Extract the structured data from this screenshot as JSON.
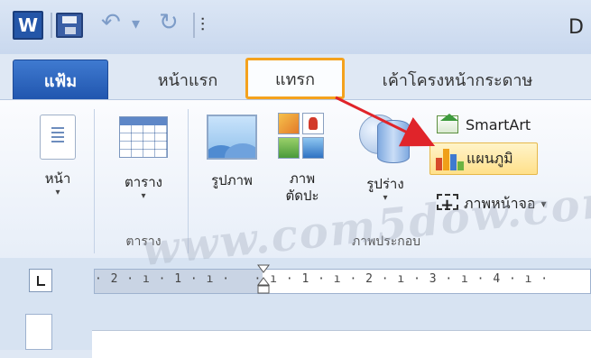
{
  "titlebar": {
    "app_icon_letter": "W",
    "title_partial": "D",
    "undo_glyph": "↶",
    "dropdown_glyph": "▾",
    "redo_glyph": "↻",
    "customize_glyph": "⫶"
  },
  "tabs": {
    "file": "แฟ้ม",
    "home": "หน้าแรก",
    "insert": "แทรก",
    "page_layout": "เค้าโครงหน้ากระดาษ"
  },
  "ribbon": {
    "pages_label": "หน้า",
    "table_label": "ตาราง",
    "table_group_label": "ตาราง",
    "picture_label": "รูปภาพ",
    "clipart_label_1": "ภาพ",
    "clipart_label_2": "ตัดปะ",
    "shapes_label": "รูปร่าง",
    "illustrations_group_label": "ภาพประกอบ",
    "smartart_label": "SmartArt",
    "chart_label": "แผนภูมิ",
    "screenshot_label": "ภาพหน้าจอ",
    "dropdown_glyph": "▾"
  },
  "ruler": {
    "text": "· 2 · ı · 1 · ı ·   · ı · 1 · ı · 2 · ı · 3 · ı · 4 · ı ·"
  },
  "watermark": {
    "text": "www.com5dow.com"
  },
  "colors": {
    "file_tab": "#2c63bd",
    "insert_highlight": "#f4a21d",
    "chart_hover": "#ffe08a",
    "arrow": "#e0242a"
  }
}
